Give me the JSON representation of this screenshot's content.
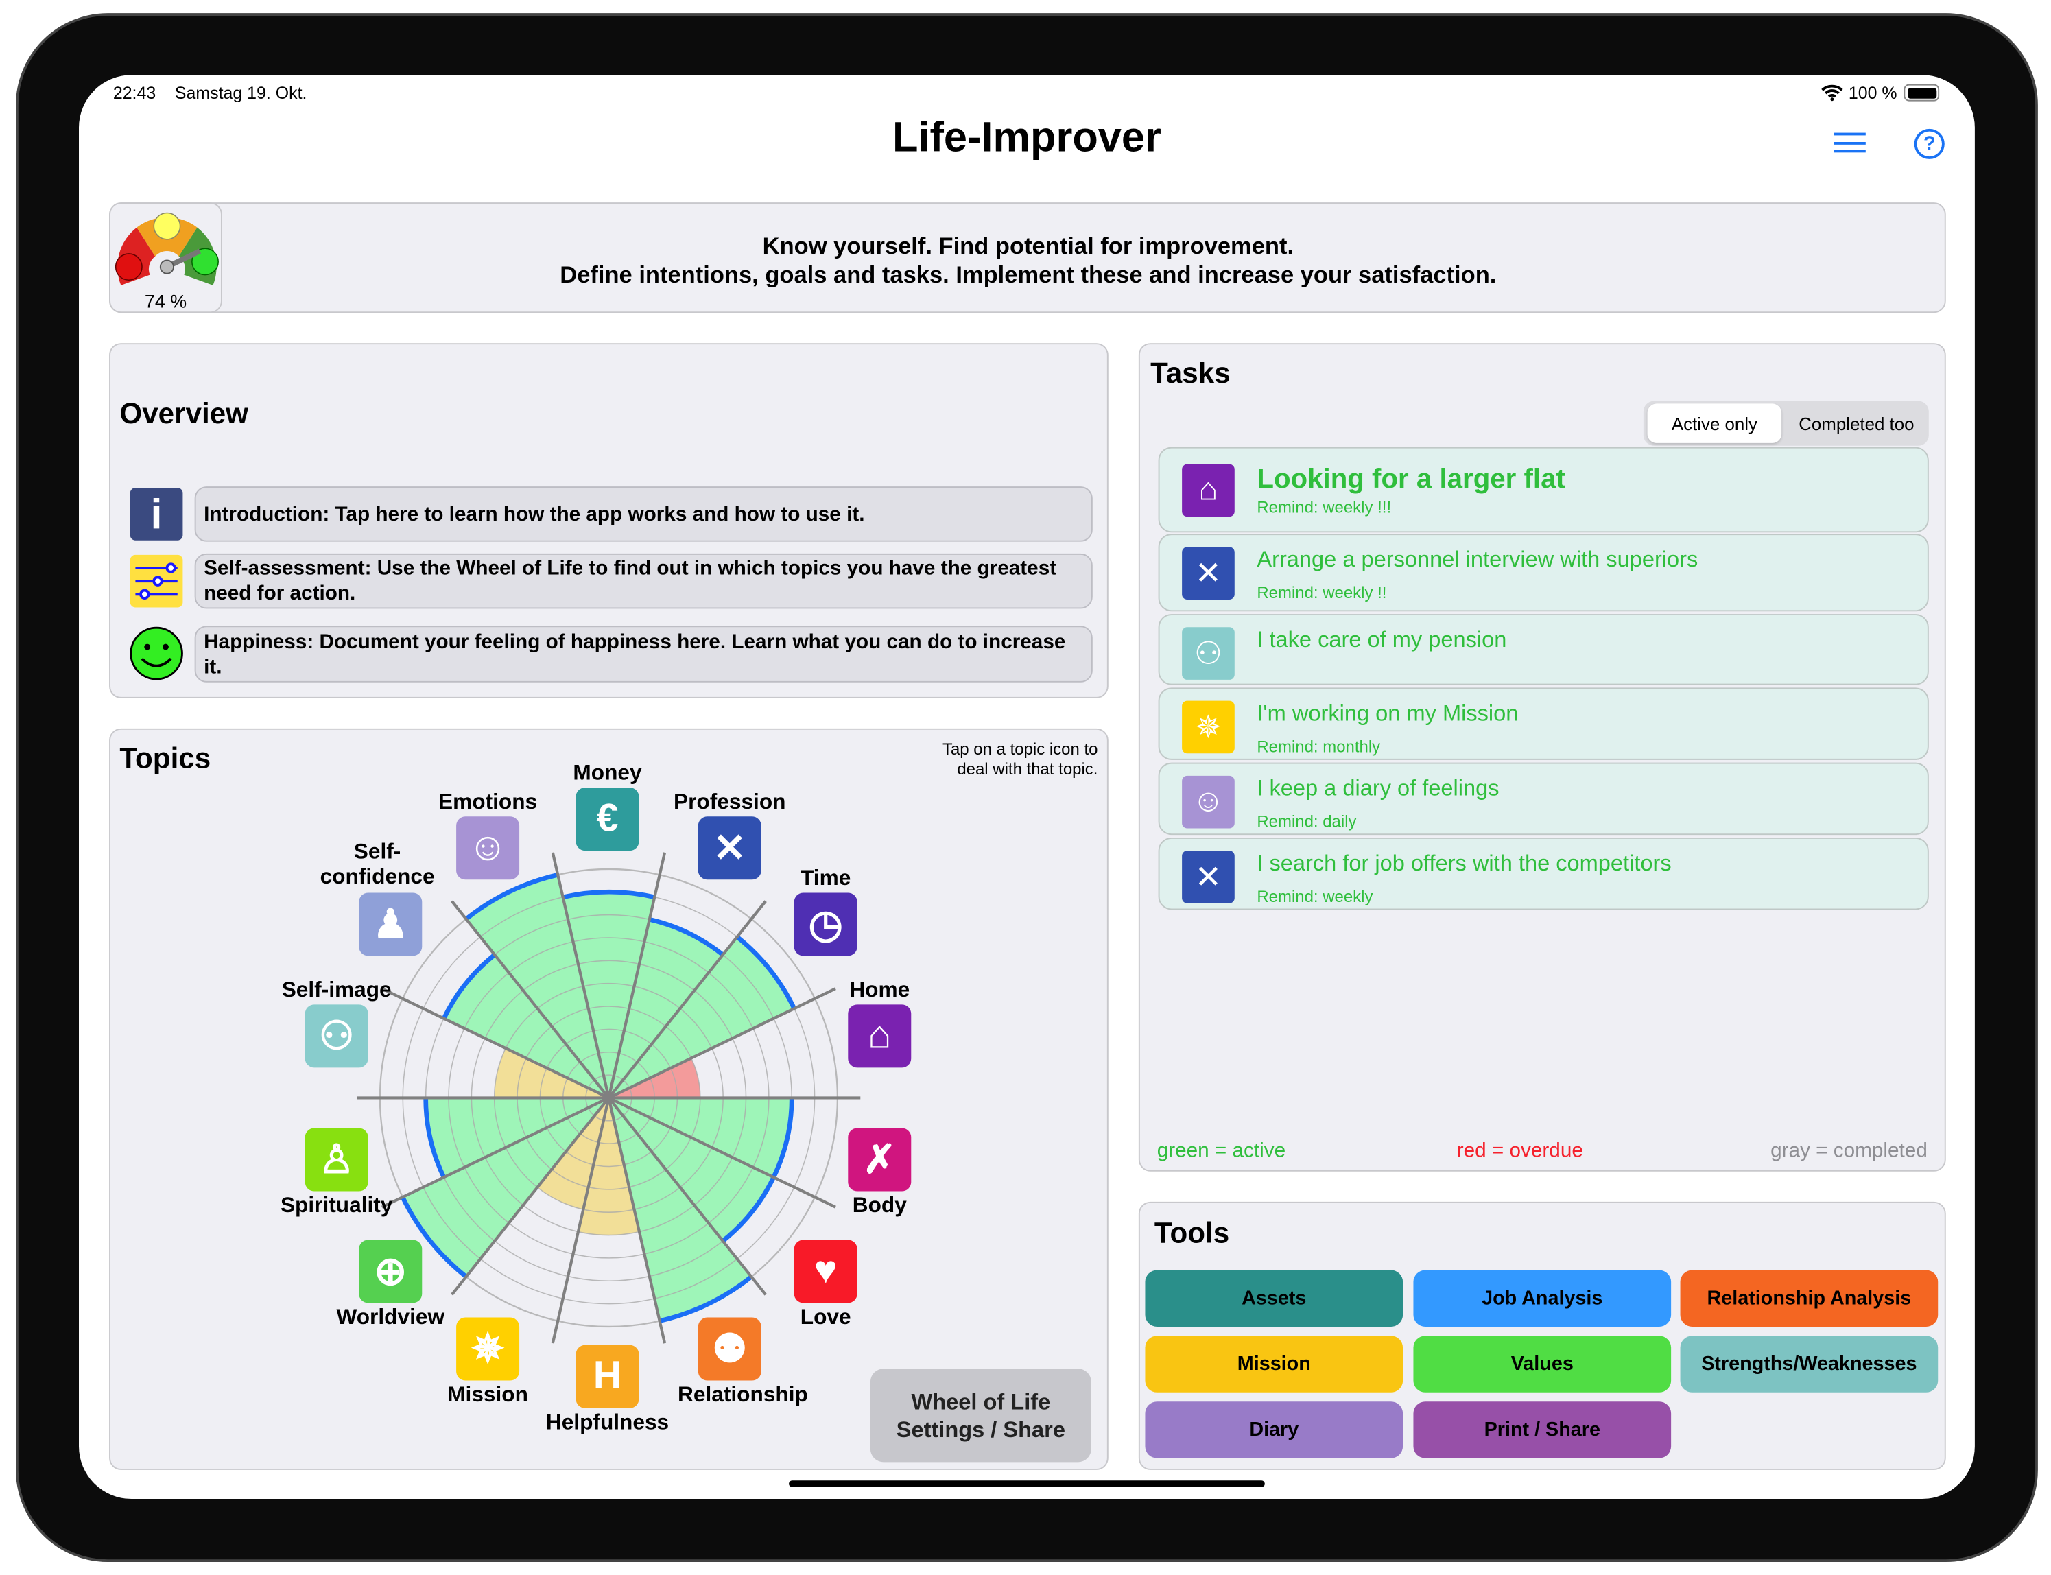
{
  "status_bar": {
    "time": "22:43",
    "date": "Samstag 19. Okt.",
    "battery": "100 %"
  },
  "header": {
    "title": "Life-Improver",
    "menu_icon": "hamburger-icon",
    "help_icon": "question-circle-icon"
  },
  "banner": {
    "gauge_percent": "74 %",
    "gauge_value": 74,
    "line1": "Know yourself. Find potential for improvement.",
    "line2": "Define intentions, goals and tasks. Implement these and increase your satisfaction."
  },
  "overview": {
    "title": "Overview",
    "items": [
      {
        "icon": "info-icon",
        "text": "Introduction: Tap here to learn how the app works and how to use it."
      },
      {
        "icon": "sliders-icon",
        "text": "Self-assessment: Use the Wheel of Life to find out in which topics you have the greatest need for action."
      },
      {
        "icon": "smiley-icon",
        "text": "Happiness: Document your feeling of happiness here. Learn what you can do to increase it."
      }
    ]
  },
  "topics": {
    "title": "Topics",
    "hint": "Tap on a topic icon to deal with that topic.",
    "settings_button": "Wheel of Life Settings / Share",
    "scale_max": 10,
    "items": [
      {
        "name": "Home",
        "value": 4,
        "color": "#7a22b0",
        "icon": "house-icon",
        "glyph": "⌂"
      },
      {
        "name": "Time",
        "value": 9,
        "color": "#4f2fb3",
        "icon": "clock-icon",
        "glyph": "◷"
      },
      {
        "name": "Profession",
        "value": 8,
        "color": "#3050b0",
        "icon": "tools-icon",
        "glyph": "✕"
      },
      {
        "name": "Money",
        "value": 9,
        "color": "#2e9c9c",
        "icon": "money-bag-icon",
        "glyph": "€"
      },
      {
        "name": "Emotions",
        "value": 10,
        "color": "#a793d4",
        "icon": "smiley-icon",
        "glyph": "☺"
      },
      {
        "name": "Self-confidence",
        "value": 8,
        "color": "#8fa0d8",
        "icon": "person-glow-icon",
        "glyph": "♟"
      },
      {
        "name": "Self-image",
        "value": 5,
        "color": "#88cccc",
        "icon": "mirror-icon",
        "glyph": "⚇"
      },
      {
        "name": "Spirituality",
        "value": 8,
        "color": "#88e010",
        "icon": "praying-icon",
        "glyph": "♙"
      },
      {
        "name": "Worldview",
        "value": 10,
        "color": "#55d050",
        "icon": "globe-icon",
        "glyph": "⊕"
      },
      {
        "name": "Mission",
        "value": 5,
        "color": "#ffd000",
        "icon": "compass-icon",
        "glyph": "✵"
      },
      {
        "name": "Helpfulness",
        "value": 6,
        "color": "#f8a820",
        "icon": "h-icon",
        "glyph": "H"
      },
      {
        "name": "Relationship",
        "value": 10,
        "color": "#f47a28",
        "icon": "people-icon",
        "glyph": "⚉"
      },
      {
        "name": "Love",
        "value": 8,
        "color": "#f81a28",
        "icon": "heart-icon",
        "glyph": "♥"
      },
      {
        "name": "Body",
        "value": 8,
        "color": "#d0157f",
        "icon": "running-icon",
        "glyph": "✗"
      }
    ],
    "fill_colors": {
      "low": "#f39b9b",
      "mid": "#f2df98",
      "high": "#9ef5b8",
      "outline": "#1a6ef5"
    }
  },
  "tasks": {
    "title": "Tasks",
    "filter": {
      "options": [
        "Active only",
        "Completed too"
      ],
      "selected": "Active only"
    },
    "items": [
      {
        "title": "Looking for a larger flat",
        "remind": "Remind: weekly !!!",
        "icon": "house-icon",
        "glyph": "⌂",
        "color": "#7a22b0"
      },
      {
        "title": "Arrange a personnel interview with superiors",
        "remind": "Remind: weekly  !!",
        "icon": "tools-icon",
        "glyph": "✕",
        "color": "#3050b0"
      },
      {
        "title": "I take care of my pension",
        "remind": "",
        "icon": "mirror-icon",
        "glyph": "⚇",
        "color": "#88cccc"
      },
      {
        "title": "I'm working on my Mission",
        "remind": "Remind: monthly",
        "icon": "compass-icon",
        "glyph": "✵",
        "color": "#ffd000"
      },
      {
        "title": "I keep a diary of feelings",
        "remind": "Remind: daily",
        "icon": "smiley-icon",
        "glyph": "☺",
        "color": "#a793d4"
      },
      {
        "title": "I search for job offers with the competitors",
        "remind": "Remind: weekly",
        "icon": "tools-icon",
        "glyph": "✕",
        "color": "#3050b0"
      }
    ],
    "legend": {
      "active": "green = active",
      "overdue": "red = overdue",
      "completed": "gray = completed"
    },
    "legend_colors": {
      "active": "#2fbe3c",
      "overdue": "#f5222d",
      "completed": "#8e8e93"
    }
  },
  "tools": {
    "title": "Tools",
    "buttons": [
      {
        "label": "Assets",
        "color": "#2a8f8a"
      },
      {
        "label": "Job Analysis",
        "color": "#3399ff"
      },
      {
        "label": "Relationship Analysis",
        "color": "#f46622"
      },
      {
        "label": "Mission",
        "color": "#f9c512"
      },
      {
        "label": "Values",
        "color": "#50dd44"
      },
      {
        "label": "Strengths/Weaknesses",
        "color": "#7dc3c2"
      },
      {
        "label": "Diary",
        "color": "#987bc8"
      },
      {
        "label": "Print / Share",
        "color": "#9750a8"
      }
    ]
  }
}
